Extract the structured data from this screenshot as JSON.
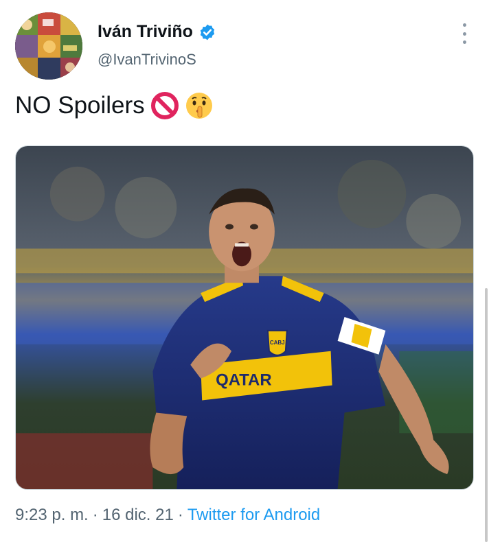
{
  "user": {
    "name": "Iván Triviño",
    "handle": "@IvanTrivinoS",
    "verified": true,
    "verified_color": "#1d9bf0"
  },
  "tweet": {
    "text": "NO Spoilers",
    "emojis": [
      "no-entry-sign-icon",
      "shushing-face-icon"
    ]
  },
  "media": {
    "jersey_text": "QATAR",
    "badge_text": "CABJ"
  },
  "meta": {
    "time": "9:23 p. m.",
    "date": "16 dic. 21",
    "source": "Twitter for Android",
    "separator": "·"
  },
  "colors": {
    "link": "#1d9bf0",
    "muted": "#536471",
    "jersey_blue": "#1d2a6b",
    "jersey_gold": "#f2c20a"
  }
}
